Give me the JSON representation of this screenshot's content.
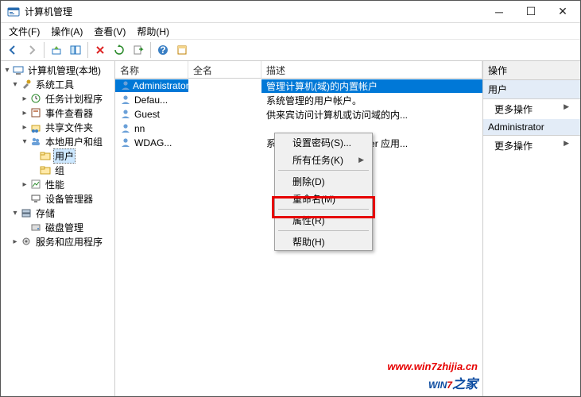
{
  "window": {
    "title": "计算机管理"
  },
  "menus": {
    "file": "文件(F)",
    "action": "操作(A)",
    "view": "查看(V)",
    "help": "帮助(H)"
  },
  "tree": {
    "root": "计算机管理(本地)",
    "system_tools": "系统工具",
    "task_scheduler": "任务计划程序",
    "event_viewer": "事件查看器",
    "shared_folders": "共享文件夹",
    "local_users": "本地用户和组",
    "users": "用户",
    "groups": "组",
    "performance": "性能",
    "device_manager": "设备管理器",
    "storage": "存储",
    "disk_mgmt": "磁盘管理",
    "services_apps": "服务和应用程序"
  },
  "columns": {
    "name": "名称",
    "fullname": "全名",
    "description": "描述"
  },
  "users_list": [
    {
      "name": "Administrator",
      "full": "",
      "desc": "管理计算机(域)的内置帐户"
    },
    {
      "name": "Defau...",
      "full": "",
      "desc": "系统管理的用户帐户。"
    },
    {
      "name": "Guest",
      "full": "",
      "desc": "供来宾访问计算机或访问域的内..."
    },
    {
      "name": "nn",
      "full": "",
      "desc": ""
    },
    {
      "name": "WDAG...",
      "full": "",
      "desc": "系统为 Windows Defender 应用..."
    }
  ],
  "context_menu": {
    "set_password": "设置密码(S)...",
    "all_tasks": "所有任务(K)",
    "delete": "删除(D)",
    "rename": "重命名(M)",
    "properties": "属性(R)",
    "help": "帮助(H)"
  },
  "actions": {
    "title": "操作",
    "group1": "用户",
    "more_ops": "更多操作",
    "group2": "Administrator"
  },
  "watermark": {
    "url": "www.win7zhijia.cn",
    "logo_a": "WIN",
    "logo_b": "7",
    "logo_c": "之家"
  }
}
